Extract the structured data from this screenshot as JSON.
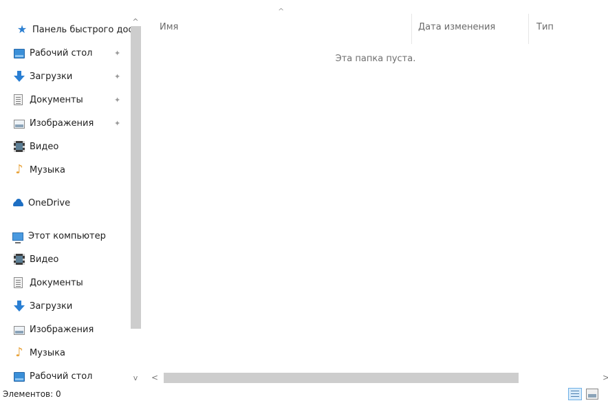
{
  "sidebar": {
    "items": [
      {
        "label": "Панель быстрого доступа",
        "icon": "quick-access-star-icon",
        "pinned": false
      },
      {
        "label": "Рабочий стол",
        "icon": "desktop-icon",
        "pinned": true
      },
      {
        "label": "Загрузки",
        "icon": "downloads-arrow-icon",
        "pinned": true
      },
      {
        "label": "Документы",
        "icon": "documents-icon",
        "pinned": true
      },
      {
        "label": "Изображения",
        "icon": "pictures-icon",
        "pinned": true
      },
      {
        "label": "Видео",
        "icon": "video-icon",
        "pinned": false
      },
      {
        "label": "Музыка",
        "icon": "music-icon",
        "pinned": false
      },
      {
        "label": "OneDrive",
        "icon": "onedrive-cloud-icon",
        "pinned": false
      },
      {
        "label": "Этот компьютер",
        "icon": "this-pc-icon",
        "pinned": false
      },
      {
        "label": "Видео",
        "icon": "video-icon",
        "pinned": false
      },
      {
        "label": "Документы",
        "icon": "documents-icon",
        "pinned": false
      },
      {
        "label": "Загрузки",
        "icon": "downloads-arrow-icon",
        "pinned": false
      },
      {
        "label": "Изображения",
        "icon": "pictures-icon",
        "pinned": false
      },
      {
        "label": "Музыка",
        "icon": "music-icon",
        "pinned": false
      },
      {
        "label": "Рабочий стол",
        "icon": "desktop-icon",
        "pinned": false
      }
    ],
    "pin_glyph": "📌",
    "scroll_up_glyph": "^",
    "scroll_down_glyph": "v"
  },
  "file_list": {
    "columns": [
      {
        "label": "Имя"
      },
      {
        "label": "Дата изменения"
      },
      {
        "label": "Тип"
      }
    ],
    "sort_glyph": "^",
    "empty_message": "Эта папка пуста."
  },
  "hscroll": {
    "left_glyph": "<",
    "right_glyph": ">"
  },
  "status_bar": {
    "items_count_text": "Элементов: 0"
  },
  "colors": {
    "accent": "#2a7fd3",
    "scroll_thumb": "#cdcdcd"
  }
}
